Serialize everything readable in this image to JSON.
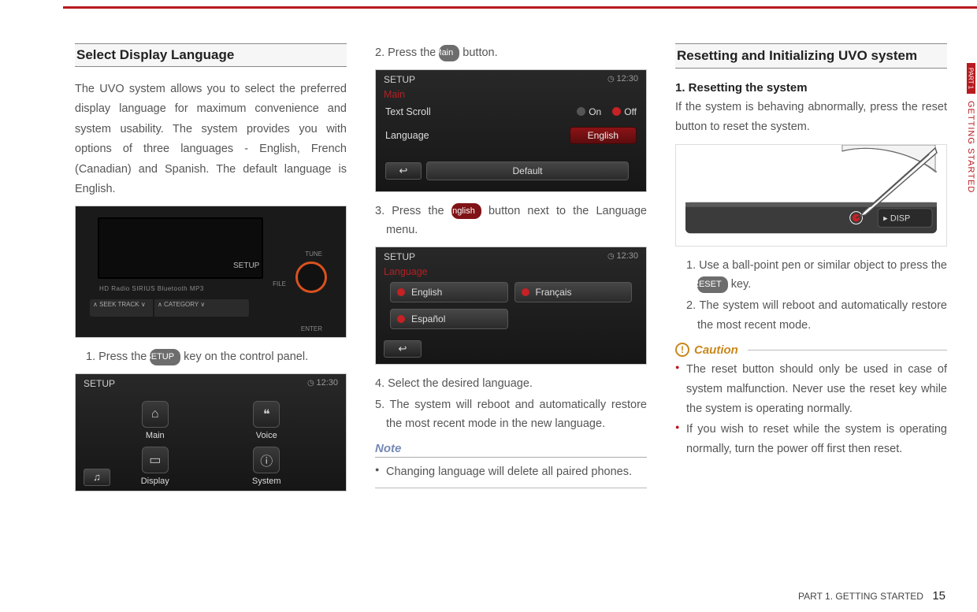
{
  "side_tab": {
    "part": "PART 1",
    "label": "GETTING STARTED"
  },
  "col1": {
    "heading": "Select Display Language",
    "intro": "The UVO system allows you to select the preferred display language for maximum convenience and system usability. The system provides you with options of three languages - English, French (Canadian) and Spanish. The default language is English.",
    "fig1": {
      "setup": "SETUP",
      "tune": "TUNE",
      "file": "FILE",
      "row_labels": "HD Radio  SIRIUS  Bluetooth  MP3",
      "seek": "∧ SEEK\nTRACK ∨",
      "category": "∧ CATEGORY ∨",
      "enter": "ENTER"
    },
    "step1": {
      "before": "1. Press the ",
      "chip": "SETUP",
      "after": " key on the control panel."
    },
    "fig2": {
      "title": "SETUP",
      "clock": "12:30",
      "items": [
        "Main",
        "Voice",
        "Display",
        "System"
      ]
    }
  },
  "col2": {
    "step2": {
      "before": "2. Press the ",
      "chip": "Main",
      "after": " button."
    },
    "fig1": {
      "title": "SETUP",
      "clock": "12:30",
      "subtitle": "Main",
      "row1": {
        "label": "Text Scroll",
        "on": "On",
        "off": "Off"
      },
      "row2": {
        "label": "Language",
        "value": "English"
      },
      "default_btn": "Default"
    },
    "step3": {
      "before": "3. Press the ",
      "chip": "English",
      "after": " button next to the Language menu."
    },
    "fig2": {
      "title": "SETUP",
      "clock": "12:30",
      "subtitle": "Language",
      "options": [
        "English",
        "Français",
        "Español"
      ]
    },
    "step4": "4. Select the desired language.",
    "step5": "5. The system will reboot and automatically restore the most recent mode in the new language.",
    "note": {
      "heading": "Note",
      "items": [
        "Changing language will delete all paired phones."
      ]
    }
  },
  "col3": {
    "heading": "Resetting and Initializing UVO system",
    "subhead": "1. Resetting the system",
    "intro": "If the system is behaving abnormally, press the reset button to reset the system.",
    "step1": {
      "before": "1. Use a ball-point pen or similar object to press the ",
      "chip": "RESET",
      "after": " key."
    },
    "step2": "2. The system will reboot and automatically restore the most recent mode.",
    "caution": {
      "heading": "Caution",
      "items": [
        "The reset button should only be used in case of system malfunction. Never use the reset key while the system is operating normally.",
        "If you wish to reset while the system is operating normally, turn the power off first then reset."
      ]
    }
  },
  "footer": {
    "section": "PART 1. GETTING STARTED",
    "page": "15"
  }
}
